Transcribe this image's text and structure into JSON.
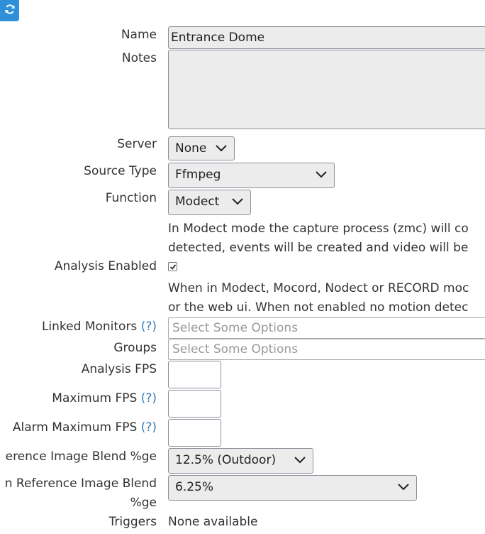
{
  "toolbar": {
    "refresh_icon": "refresh-icon",
    "accent": "#2f8fd8"
  },
  "form": {
    "name": {
      "label": "Name",
      "value": "Entrance Dome"
    },
    "notes": {
      "label": "Notes",
      "value": ""
    },
    "server": {
      "label": "Server",
      "value": "None"
    },
    "source_type": {
      "label": "Source Type",
      "value": "Ffmpeg"
    },
    "function": {
      "label": "Function",
      "value": "Modect",
      "help_line1": "In Modect mode the capture process (zmc) will co",
      "help_line2": "detected, events will be created and video will be"
    },
    "analysis_enabled": {
      "label": "Analysis Enabled",
      "checked": true,
      "help_line1": "When in Modect, Mocord, Nodect or RECORD moc",
      "help_line2": "or the web ui. When not enabled no motion detec"
    },
    "linked_monitors": {
      "label": "Linked Monitors",
      "help_marker": "(?)",
      "placeholder": "Select Some Options"
    },
    "groups": {
      "label": "Groups",
      "placeholder": "Select Some Options"
    },
    "analysis_fps": {
      "label": "Analysis FPS",
      "value": ""
    },
    "maximum_fps": {
      "label": "Maximum FPS",
      "help_marker": "(?)",
      "value": ""
    },
    "alarm_maximum_fps": {
      "label": "Alarm Maximum FPS",
      "help_marker": "(?)",
      "value": ""
    },
    "ref_blend": {
      "label": "erence Image Blend %ge",
      "value": "12.5% (Outdoor)"
    },
    "alarm_ref_blend": {
      "label_line1": "n Reference Image Blend",
      "label_line2": "%ge",
      "value": "6.25%"
    },
    "triggers": {
      "label": "Triggers",
      "value": "None available"
    }
  }
}
